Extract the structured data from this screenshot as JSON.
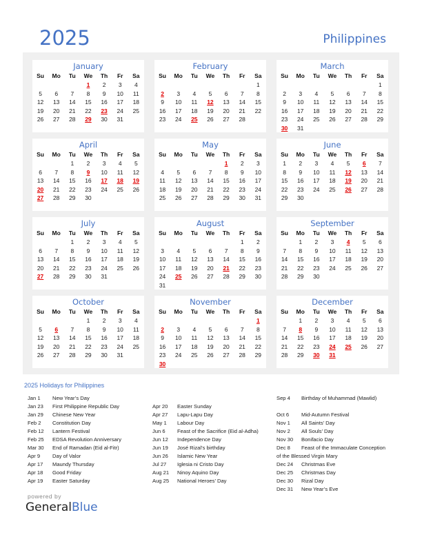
{
  "header": {
    "year": "2025",
    "country": "Philippines"
  },
  "colors": {
    "accent": "#4472c4",
    "holiday": "#e00000",
    "panel_bg": "#f0f0f0"
  },
  "weekdays": [
    "Su",
    "Mo",
    "Tu",
    "We",
    "Th",
    "Fr",
    "Sa"
  ],
  "months": [
    {
      "name": "January",
      "first_weekday": 3,
      "days": 31,
      "holidays": [
        1,
        23,
        29
      ]
    },
    {
      "name": "February",
      "first_weekday": 6,
      "days": 28,
      "holidays": [
        2,
        12,
        25
      ]
    },
    {
      "name": "March",
      "first_weekday": 6,
      "days": 31,
      "holidays": [
        30
      ]
    },
    {
      "name": "April",
      "first_weekday": 2,
      "days": 30,
      "holidays": [
        9,
        17,
        18,
        19,
        20,
        27
      ]
    },
    {
      "name": "May",
      "first_weekday": 4,
      "days": 31,
      "holidays": [
        1
      ]
    },
    {
      "name": "June",
      "first_weekday": 0,
      "days": 30,
      "holidays": [
        6,
        12,
        19,
        26
      ]
    },
    {
      "name": "July",
      "first_weekday": 2,
      "days": 31,
      "holidays": [
        27
      ]
    },
    {
      "name": "August",
      "first_weekday": 5,
      "days": 31,
      "holidays": [
        21,
        25
      ]
    },
    {
      "name": "September",
      "first_weekday": 1,
      "days": 30,
      "holidays": [
        4
      ]
    },
    {
      "name": "October",
      "first_weekday": 3,
      "days": 31,
      "holidays": [
        6
      ]
    },
    {
      "name": "November",
      "first_weekday": 6,
      "days": 30,
      "holidays": [
        1,
        2,
        30
      ]
    },
    {
      "name": "December",
      "first_weekday": 1,
      "days": 31,
      "holidays": [
        8,
        24,
        25,
        30,
        31
      ]
    }
  ],
  "holiday_list": {
    "title": "2025 Holidays for Philippines",
    "columns": [
      [
        {
          "date": "Jan 1",
          "name": "New Year’s Day"
        },
        {
          "date": "Jan 23",
          "name": "First Philippine Republic Day"
        },
        {
          "date": "Jan 29",
          "name": "Chinese New Year"
        },
        {
          "date": "Feb 2",
          "name": "Constitution Day"
        },
        {
          "date": "Feb 12",
          "name": "Lantern Festival"
        },
        {
          "date": "Feb 25",
          "name": "EDSA Revolution Anniversary"
        },
        {
          "date": "Mar 30",
          "name": "End of Ramadan (Eid al-Fitr)"
        },
        {
          "date": "Apr 9",
          "name": "Day of Valor"
        },
        {
          "date": "Apr 17",
          "name": "Maundy Thursday"
        },
        {
          "date": "Apr 18",
          "name": "Good Friday"
        },
        {
          "date": "Apr 19",
          "name": "Easter Saturday"
        }
      ],
      [
        {
          "date": "Apr 20",
          "name": "Easter Sunday"
        },
        {
          "date": "Apr 27",
          "name": "Lapu-Lapu Day"
        },
        {
          "date": "May 1",
          "name": "Labour Day"
        },
        {
          "date": "Jun 6",
          "name": "Feast of the Sacrifice (Eid al-Adha)"
        },
        {
          "date": "Jun 12",
          "name": "Independence Day"
        },
        {
          "date": "Jun 19",
          "name": "José Rizal’s birthday"
        },
        {
          "date": "Jun 26",
          "name": "Islamic New Year"
        },
        {
          "date": "Jul 27",
          "name": "Iglesia ni Cristo Day"
        },
        {
          "date": "Aug 21",
          "name": "Ninoy Aquino Day"
        },
        {
          "date": "Aug 25",
          "name": "National Heroes’ Day"
        }
      ],
      [
        {
          "date": "Sep 4",
          "name": "Birthday of Muhammad (Mawlid)"
        },
        {
          "date": "",
          "name": ""
        },
        {
          "date": "Oct 6",
          "name": "Mid-Autumn Festival"
        },
        {
          "date": "Nov 1",
          "name": "All Saints’ Day"
        },
        {
          "date": "Nov 2",
          "name": "All Souls’ Day"
        },
        {
          "date": "Nov 30",
          "name": "Bonifacio Day"
        },
        {
          "date": "Dec 8",
          "name": "Feast of the Immaculate Conception"
        },
        {
          "date": "",
          "name": "of the Blessed Virgin Mary",
          "continuation": true
        },
        {
          "date": "Dec 24",
          "name": "Christmas Eve"
        },
        {
          "date": "Dec 25",
          "name": "Christmas Day"
        },
        {
          "date": "Dec 30",
          "name": "Rizal Day"
        },
        {
          "date": "Dec 31",
          "name": "New Year’s Eve"
        }
      ]
    ]
  },
  "footer": {
    "powered_by": "powered by",
    "brand_general": "General",
    "brand_blue": "Blue"
  }
}
